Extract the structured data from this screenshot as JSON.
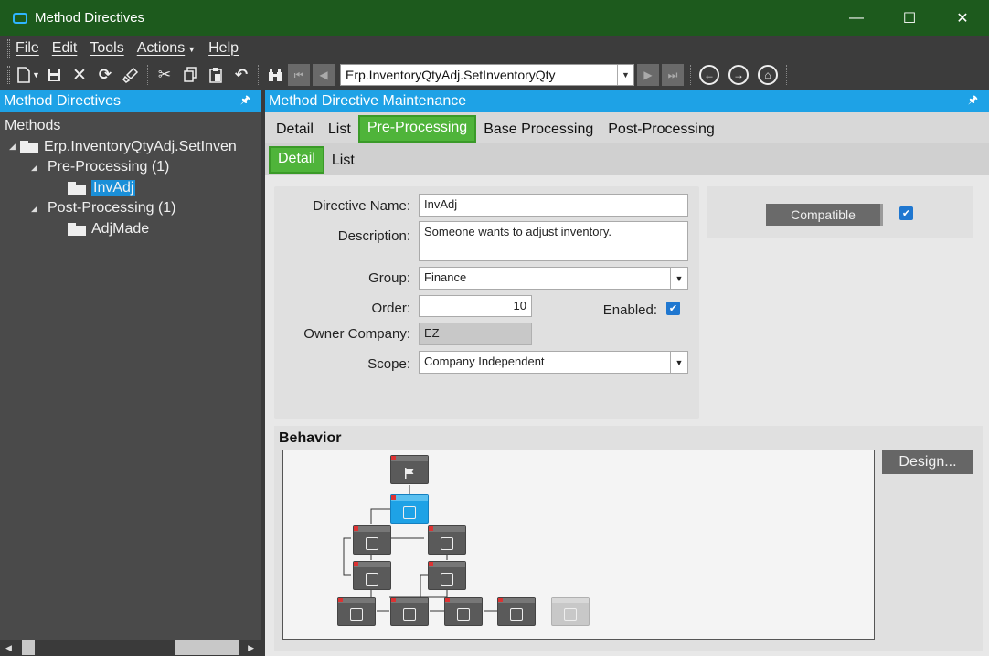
{
  "window": {
    "title": "Method Directives",
    "minimize": "—",
    "maximize": "☐",
    "close": "✕"
  },
  "menu": [
    "File",
    "Edit",
    "Tools",
    "Actions",
    "Help"
  ],
  "toolbar": {
    "method_value": "Erp.InventoryQtyAdj.SetInventoryQty"
  },
  "left_panel": {
    "header": "Method Directives",
    "pin": "🖈",
    "tree": {
      "root_label": "Methods",
      "method": "Erp.InventoryQtyAdj.SetInven",
      "pre": "Pre-Processing (1)",
      "pre_item": "InvAdj",
      "post": "Post-Processing (1)",
      "post_item": "AdjMade"
    }
  },
  "right_panel": {
    "header": "Method Directive Maintenance",
    "pin": "🖈",
    "tabs": [
      "Detail",
      "List",
      "Pre-Processing",
      "Base Processing",
      "Post-Processing"
    ],
    "subtabs": [
      "Detail",
      "List"
    ],
    "form": {
      "directive_name_label": "Directive Name:",
      "directive_name": "InvAdj",
      "description_label": "Description:",
      "description": "Someone wants to adjust inventory.",
      "group_label": "Group:",
      "group": "Finance",
      "order_label": "Order:",
      "order": "10",
      "enabled_label": "Enabled:",
      "owner_label": "Owner Company:",
      "owner": "EZ",
      "scope_label": "Scope:",
      "scope": "Company Independent"
    },
    "compatible_label": "Compatible",
    "behavior_title": "Behavior",
    "design_button": "Design..."
  },
  "colors": {
    "title_bar": "#1d5a1d",
    "panel_header": "#1ea2e6",
    "active_tab": "#4fb43a",
    "checkbox": "#1f77d0"
  }
}
